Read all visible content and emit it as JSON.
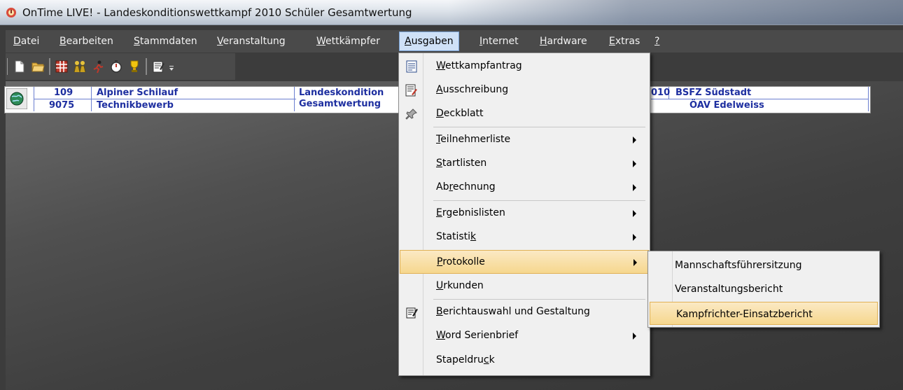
{
  "window": {
    "title": "OnTime LIVE! - Landeskonditionswettkampf 2010 Schüler Gesamtwertung"
  },
  "menubar": {
    "items": [
      {
        "pre": "",
        "ul": "D",
        "post": "atei"
      },
      {
        "pre": "",
        "ul": "B",
        "post": "earbeiten"
      },
      {
        "pre": "",
        "ul": "S",
        "post": "tammdaten"
      },
      {
        "pre": "",
        "ul": "V",
        "post": "eranstaltung"
      },
      {
        "pre": "",
        "ul": "W",
        "post": "ettkämpfer"
      },
      {
        "pre": "",
        "ul": "A",
        "post": "usgaben"
      },
      {
        "pre": "",
        "ul": "I",
        "post": "nternet"
      },
      {
        "pre": "",
        "ul": "H",
        "post": "ardware"
      },
      {
        "pre": "",
        "ul": "E",
        "post": "xtras"
      },
      {
        "pre": "",
        "ul": "?",
        "post": ""
      }
    ]
  },
  "grid": {
    "rows": [
      {
        "id": "109",
        "name": "Alpiner Schilauf",
        "event": "Landeskondition",
        "year": "010",
        "club": "BSFZ Südstadt"
      },
      {
        "id": "9075",
        "name": "Technikbewerb",
        "event": "Gesamtwertung",
        "year": "",
        "club": "ÖAV Edelweiss"
      }
    ]
  },
  "dropdown": {
    "items": [
      {
        "pre": "",
        "ul": "W",
        "post": "ettkampfantrag"
      },
      {
        "pre": "",
        "ul": "A",
        "post": "usschreibung"
      },
      {
        "pre": "",
        "ul": "D",
        "post": "eckblatt"
      },
      {
        "pre": "",
        "ul": "T",
        "post": "eilnehmerliste"
      },
      {
        "pre": "",
        "ul": "S",
        "post": "tartlisten"
      },
      {
        "pre": "Ab",
        "ul": "r",
        "post": "echnung"
      },
      {
        "pre": "",
        "ul": "E",
        "post": "rgebnislisten"
      },
      {
        "pre": "Statisti",
        "ul": "k",
        "post": ""
      },
      {
        "pre": "",
        "ul": "P",
        "post": "rotokolle"
      },
      {
        "pre": "",
        "ul": "U",
        "post": "rkunden"
      },
      {
        "pre": "",
        "ul": "B",
        "post": "erichtauswahl und Gestaltung"
      },
      {
        "pre": "",
        "ul": "W",
        "post": "ord Serienbrief"
      },
      {
        "pre": "Stapeldru",
        "ul": "c",
        "post": "k"
      }
    ]
  },
  "submenu": {
    "items": [
      {
        "label": "Mannschaftsführersitzung"
      },
      {
        "label": "Veranstaltungsbericht"
      },
      {
        "label": "Kampfrichter-Einsatzbericht"
      }
    ]
  },
  "colors": {
    "highlight": "#f6d78e",
    "link_text": "#1e2fa0",
    "menubar_bg": "#4a4a4a"
  }
}
